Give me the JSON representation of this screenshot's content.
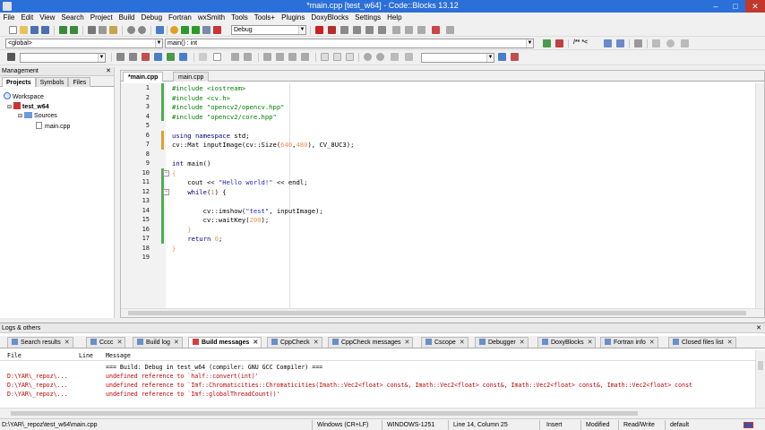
{
  "window": {
    "title": "*main.cpp [test_w64] - Code::Blocks 13.12",
    "minimize": "–",
    "maximize": "□",
    "close": "✕"
  },
  "menu": [
    "File",
    "Edit",
    "View",
    "Search",
    "Project",
    "Build",
    "Debug",
    "Fortran",
    "wxSmith",
    "Tools",
    "Tools+",
    "Plugins",
    "DoxyBlocks",
    "Settings",
    "Help"
  ],
  "toolbar": {
    "build_target": "Debug",
    "scope": "<global>",
    "function": "main() : int",
    "doxy_comment": "/** *<"
  },
  "management": {
    "title": "Management",
    "tabs": [
      "Projects",
      "Symbols",
      "Files"
    ],
    "tree": {
      "workspace": "Workspace",
      "project": "test_w64",
      "folder": "Sources",
      "file": "main.cpp"
    }
  },
  "editor": {
    "tabs": [
      "*main.cpp",
      "main.cpp"
    ],
    "line_numbers": [
      "1",
      "2",
      "3",
      "4",
      "5",
      "6",
      "7",
      "8",
      "9",
      "10",
      "11",
      "12",
      "13",
      "14",
      "15",
      "16",
      "17",
      "18",
      "19"
    ],
    "lines": [
      [
        {
          "t": "#include <iostream>",
          "c": "pp"
        }
      ],
      [
        {
          "t": "#include <cv.h>",
          "c": "pp"
        }
      ],
      [
        {
          "t": "#include \"opencv2/opencv.hpp\"",
          "c": "pp"
        }
      ],
      [
        {
          "t": "#include \"opencv2/core.hpp\"",
          "c": "pp"
        }
      ],
      [],
      [
        {
          "t": "using namespace",
          "c": "kw"
        },
        {
          "t": " std;",
          "c": ""
        }
      ],
      [
        {
          "t": "cv::Mat inputImage(cv::Size(",
          "c": ""
        },
        {
          "t": "640",
          "c": "num"
        },
        {
          "t": ",",
          "c": ""
        },
        {
          "t": "480",
          "c": "num"
        },
        {
          "t": "), CV_8UC3);",
          "c": ""
        }
      ],
      [],
      [
        {
          "t": "int",
          "c": "kw"
        },
        {
          "t": " main()",
          "c": ""
        }
      ],
      [
        {
          "t": "{",
          "c": "num"
        }
      ],
      [
        {
          "t": "    cout << ",
          "c": ""
        },
        {
          "t": "\"Hello world!\"",
          "c": "str"
        },
        {
          "t": " << endl;",
          "c": ""
        }
      ],
      [
        {
          "t": "    ",
          "c": ""
        },
        {
          "t": "while",
          "c": "kw"
        },
        {
          "t": "(",
          "c": ""
        },
        {
          "t": "1",
          "c": "num"
        },
        {
          "t": ") {",
          "c": ""
        }
      ],
      [],
      [
        {
          "t": "        cv::imshow(",
          "c": ""
        },
        {
          "t": "\"test\"",
          "c": "str"
        },
        {
          "t": ", inputImage);",
          "c": ""
        }
      ],
      [
        {
          "t": "        cv::waitKey(",
          "c": ""
        },
        {
          "t": "200",
          "c": "num"
        },
        {
          "t": ");",
          "c": ""
        }
      ],
      [
        {
          "t": "    }",
          "c": "num"
        }
      ],
      [
        {
          "t": "    ",
          "c": ""
        },
        {
          "t": "return",
          "c": "kw"
        },
        {
          "t": " ",
          "c": ""
        },
        {
          "t": "0",
          "c": "num"
        },
        {
          "t": ";",
          "c": ""
        }
      ],
      [
        {
          "t": "}",
          "c": "num"
        }
      ],
      []
    ]
  },
  "logs": {
    "title": "Logs & others",
    "tabs": [
      "Search results",
      "Cccc",
      "Build log",
      "Build messages",
      "CppCheck",
      "CppCheck messages",
      "Cscope",
      "Debugger",
      "DoxyBlocks",
      "Fortran info",
      "Closed files list"
    ],
    "columns": [
      "File",
      "Line",
      "Message"
    ],
    "rows": [
      {
        "file": "",
        "line": "",
        "msg": "=== Build: Debug in test_w64 (compiler: GNU GCC Compiler) ===",
        "err": false
      },
      {
        "file": "D:\\YAR\\_repoz\\...",
        "line": "",
        "msg": "undefined reference to `half::convert(int)'",
        "err": true
      },
      {
        "file": "D:\\YAR\\_repoz\\...",
        "line": "",
        "msg": "undefined reference to `Imf::Chromaticities::Chromaticities(Imath::Vec2<float> const&, Imath::Vec2<float> const&, Imath::Vec2<float> const&, Imath::Vec2<float> const",
        "err": true
      },
      {
        "file": "D:\\YAR\\_repoz\\...",
        "line": "",
        "msg": "undefined reference to `Imf::globalThreadCount()'",
        "err": true
      }
    ]
  },
  "status": {
    "path": "D:\\YAR\\_repoz\\test_w64\\main.cpp",
    "eol": "Windows (CR+LF)",
    "encoding": "WINDOWS-1251",
    "position": "Line 14, Column 25",
    "mode": "Insert",
    "modified": "Modified",
    "access": "Read/Write",
    "profile": "default"
  },
  "colors": {
    "titlebar": "#2b6fd8",
    "preprocessor": "#008000",
    "keyword": "#00008b",
    "string": "#1e1ec8",
    "number": "#f09050",
    "error": "#c00000"
  }
}
